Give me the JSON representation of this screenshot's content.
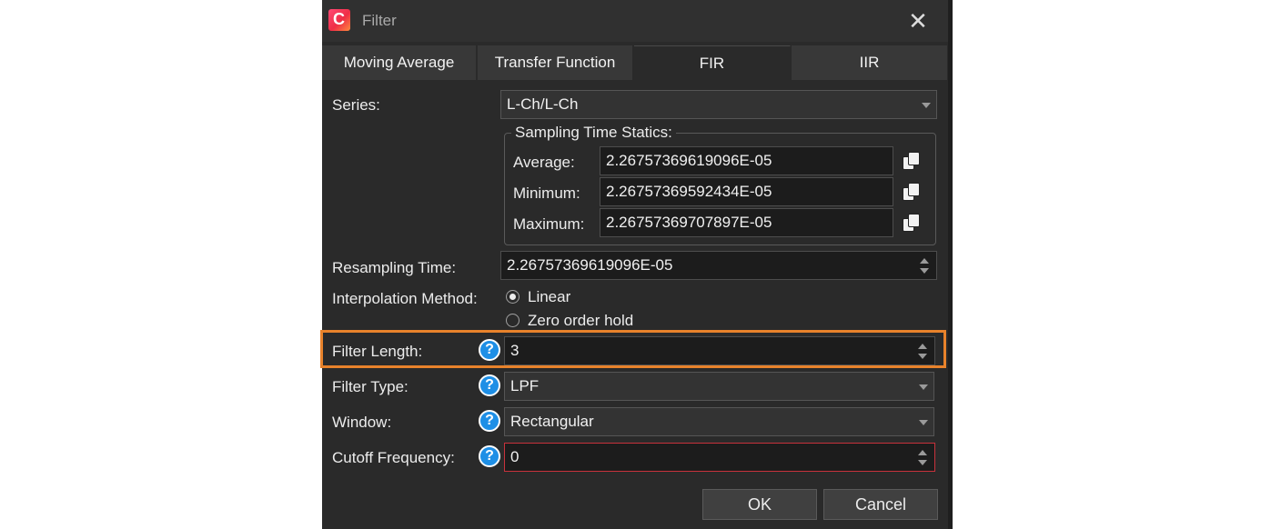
{
  "window": {
    "title": "Filter",
    "app_icon_letter": "C"
  },
  "tabs": [
    {
      "label": "Moving Average"
    },
    {
      "label": "Transfer Function"
    },
    {
      "label": "FIR"
    },
    {
      "label": "IIR"
    }
  ],
  "series": {
    "label": "Series:",
    "value": "L-Ch/L-Ch"
  },
  "sampling": {
    "title": "Sampling Time Statics:",
    "rows": [
      {
        "label": "Average:",
        "value": "2.26757369619096E-05"
      },
      {
        "label": "Minimum:",
        "value": "2.26757369592434E-05"
      },
      {
        "label": "Maximum:",
        "value": "2.26757369707897E-05"
      }
    ]
  },
  "resampling": {
    "label": "Resampling Time:",
    "value": "2.26757369619096E-05"
  },
  "interpolation": {
    "label": "Interpolation Method:",
    "options": [
      {
        "label": "Linear",
        "checked": true
      },
      {
        "label": "Zero order hold",
        "checked": false
      }
    ]
  },
  "filter_length": {
    "label": "Filter Length:",
    "value": "3"
  },
  "filter_type": {
    "label": "Filter Type:",
    "value": "LPF"
  },
  "window_fn": {
    "label": "Window:",
    "value": "Rectangular"
  },
  "cutoff": {
    "label": "Cutoff Frequency:",
    "value": "0"
  },
  "help_glyph": "?",
  "buttons": {
    "ok": "OK",
    "cancel": "Cancel"
  },
  "colors": {
    "highlight": "#e8822b",
    "error_border": "#c8323c",
    "help": "#1e8fe6"
  }
}
